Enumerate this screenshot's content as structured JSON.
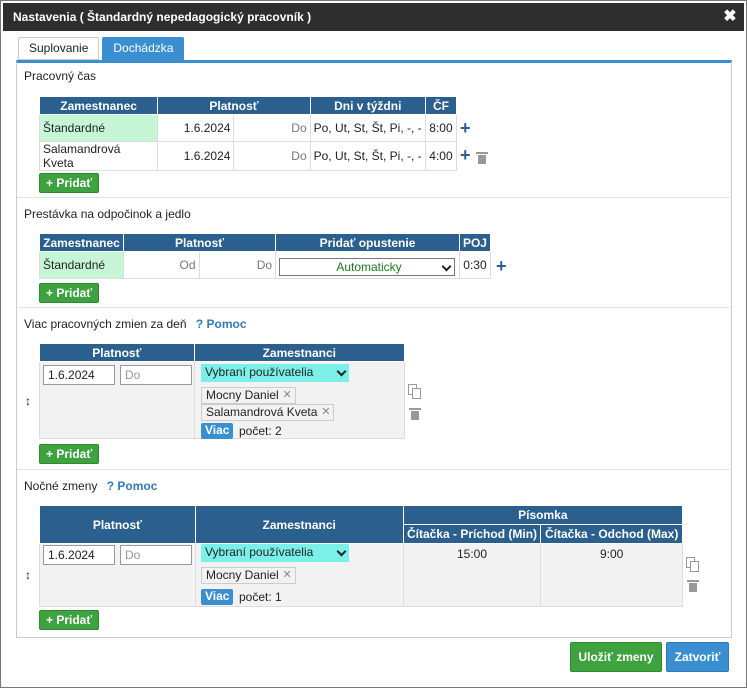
{
  "dialog": {
    "title": "Nastavenia ( Štandardný nepedagogický pracovník )",
    "close": "✖"
  },
  "tabs": [
    {
      "label": "Suplovanie"
    },
    {
      "label": "Dochádzka"
    }
  ],
  "add_label": "+ Pridať",
  "work_time": {
    "title": "Pracovný čas",
    "headers": {
      "employee": "Zamestnanec",
      "validity": "Platnosť",
      "days": "Dni v týždni",
      "cf": "ČF"
    },
    "rows": [
      {
        "employee": "Štandardné",
        "from": "1.6.2024",
        "to": "Do",
        "days": "Po, Ut, St, Št, Pi, -, -",
        "cf": "8:00"
      },
      {
        "employee": "Salamandrová Kveta",
        "from": "1.6.2024",
        "to": "Do",
        "days": "Po, Ut, St, Št, Pi, -, -",
        "cf": "4:00"
      }
    ]
  },
  "break": {
    "title": "Prestávka na odpočinok a jedlo",
    "headers": {
      "employee": "Zamestnanec",
      "validity": "Platnosť",
      "leave": "Pridať opustenie",
      "poj": "POJ"
    },
    "row": {
      "employee": "Štandardné",
      "from": "Od",
      "to": "Do",
      "leave": "Automaticky",
      "poj": "0:30"
    }
  },
  "multi_shift": {
    "title": "Viac pracovných zmien za deň",
    "help": "? Pomoc",
    "headers": {
      "validity": "Platnosť",
      "employees": "Zamestnanci"
    },
    "row": {
      "from": "1.6.2024",
      "to_placeholder": "Do",
      "select": "Vybraní používatelia",
      "chips": [
        "Mocny Daniel",
        "Salamandrová Kveta"
      ],
      "more": "Viac",
      "count": "počet: 2"
    }
  },
  "night_shift": {
    "title": "Nočné zmeny",
    "help": "? Pomoc",
    "headers": {
      "validity": "Platnosť",
      "employees": "Zamestnanci",
      "group": "Písomka",
      "arrival": "Čítačka - Príchod (Min)",
      "departure": "Čítačka - Odchod (Max)"
    },
    "row": {
      "from": "1.6.2024",
      "to_placeholder": "Do",
      "select": "Vybraní používatelia",
      "chips": [
        "Mocny Daniel"
      ],
      "more": "Viac",
      "count": "počet: 1",
      "arrival": "15:00",
      "departure": "9:00"
    }
  },
  "footer": {
    "save": "Uložiť zmeny",
    "close": "Zatvoriť"
  },
  "colors": {
    "header": "#2a5f8e",
    "accent": "#3a8fd0",
    "green_button": "#3ea33e",
    "highlight": "#c6f6d5",
    "select_cyan": "#7af0e8"
  }
}
